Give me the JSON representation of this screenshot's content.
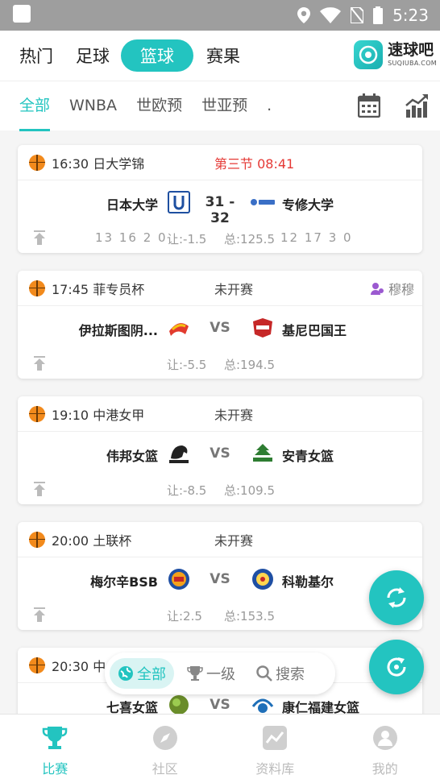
{
  "status_bar": {
    "time": "5:23"
  },
  "top_tabs": [
    "热门",
    "足球",
    "篮球",
    "赛果"
  ],
  "top_tab_active": "篮球",
  "brand": {
    "name": "速球吧",
    "url": "SUQIUBA.COM"
  },
  "sub_tabs": [
    "全部",
    "WNBA",
    "世欧预",
    "世亚预",
    "."
  ],
  "matches": [
    {
      "time_league": "16:30 日大学锦",
      "status": "第三节  08:41",
      "home": "日本大学",
      "away": "专修大学",
      "mid": "31 - 32",
      "odds_home": "13  16  2  0",
      "handicap": "让:-1.5",
      "total": "总:125.5",
      "odds_away": "12  17  3  0"
    },
    {
      "time_league": "17:45 菲专员杯",
      "status": "未开赛",
      "tip": "穆穆",
      "home": "伊拉斯图阴...",
      "away": "基尼巴国王",
      "mid": "VS",
      "handicap": "让:-5.5",
      "total": "总:194.5"
    },
    {
      "time_league": "19:10 中港女甲",
      "status": "未开赛",
      "home": "伟邦女篮",
      "away": "安青女篮",
      "mid": "VS",
      "handicap": "让:-8.5",
      "total": "总:109.5"
    },
    {
      "time_league": "20:00 土联杯",
      "status": "未开赛",
      "home": "梅尔辛BSB",
      "away": "科勒基尔",
      "mid": "VS",
      "handicap": "让:2.5",
      "total": "总:153.5"
    },
    {
      "time_league": "20:30 中",
      "home": "七喜女篮",
      "away": "康仁福建女篮",
      "mid": "VS"
    }
  ],
  "filter_bar": {
    "all": "全部",
    "first": "一级",
    "search": "搜索"
  },
  "bottom_nav": [
    "比赛",
    "社区",
    "资料库",
    "我的"
  ],
  "colors": {
    "accent": "#23c4c0",
    "live": "#e53935"
  }
}
